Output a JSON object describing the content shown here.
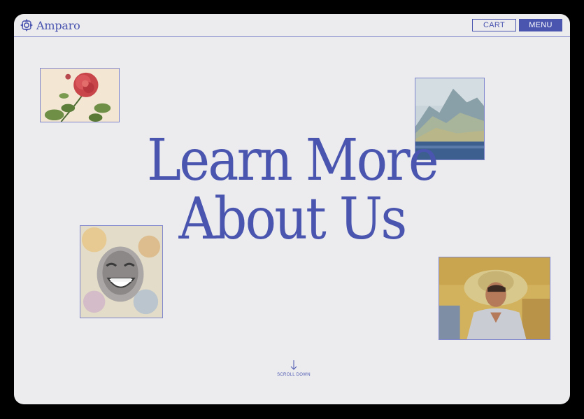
{
  "brand": {
    "name": "Amparo",
    "logo_icon": "amparo-logo-icon"
  },
  "nav": {
    "cart_label": "CART",
    "menu_label": "MENU"
  },
  "hero": {
    "line1": "Learn More",
    "line2": "About Us"
  },
  "scroll": {
    "label": "SCROLL DOWN",
    "icon": "arrow-down-icon"
  },
  "artworks": [
    {
      "subject": "rose-painting"
    },
    {
      "subject": "mountain-lake-painting"
    },
    {
      "subject": "laughing-woman-painting"
    },
    {
      "subject": "woman-in-straw-hat-painting"
    }
  ],
  "colors": {
    "accent": "#4a55b0",
    "background": "#ececee",
    "frame": "#000000"
  }
}
